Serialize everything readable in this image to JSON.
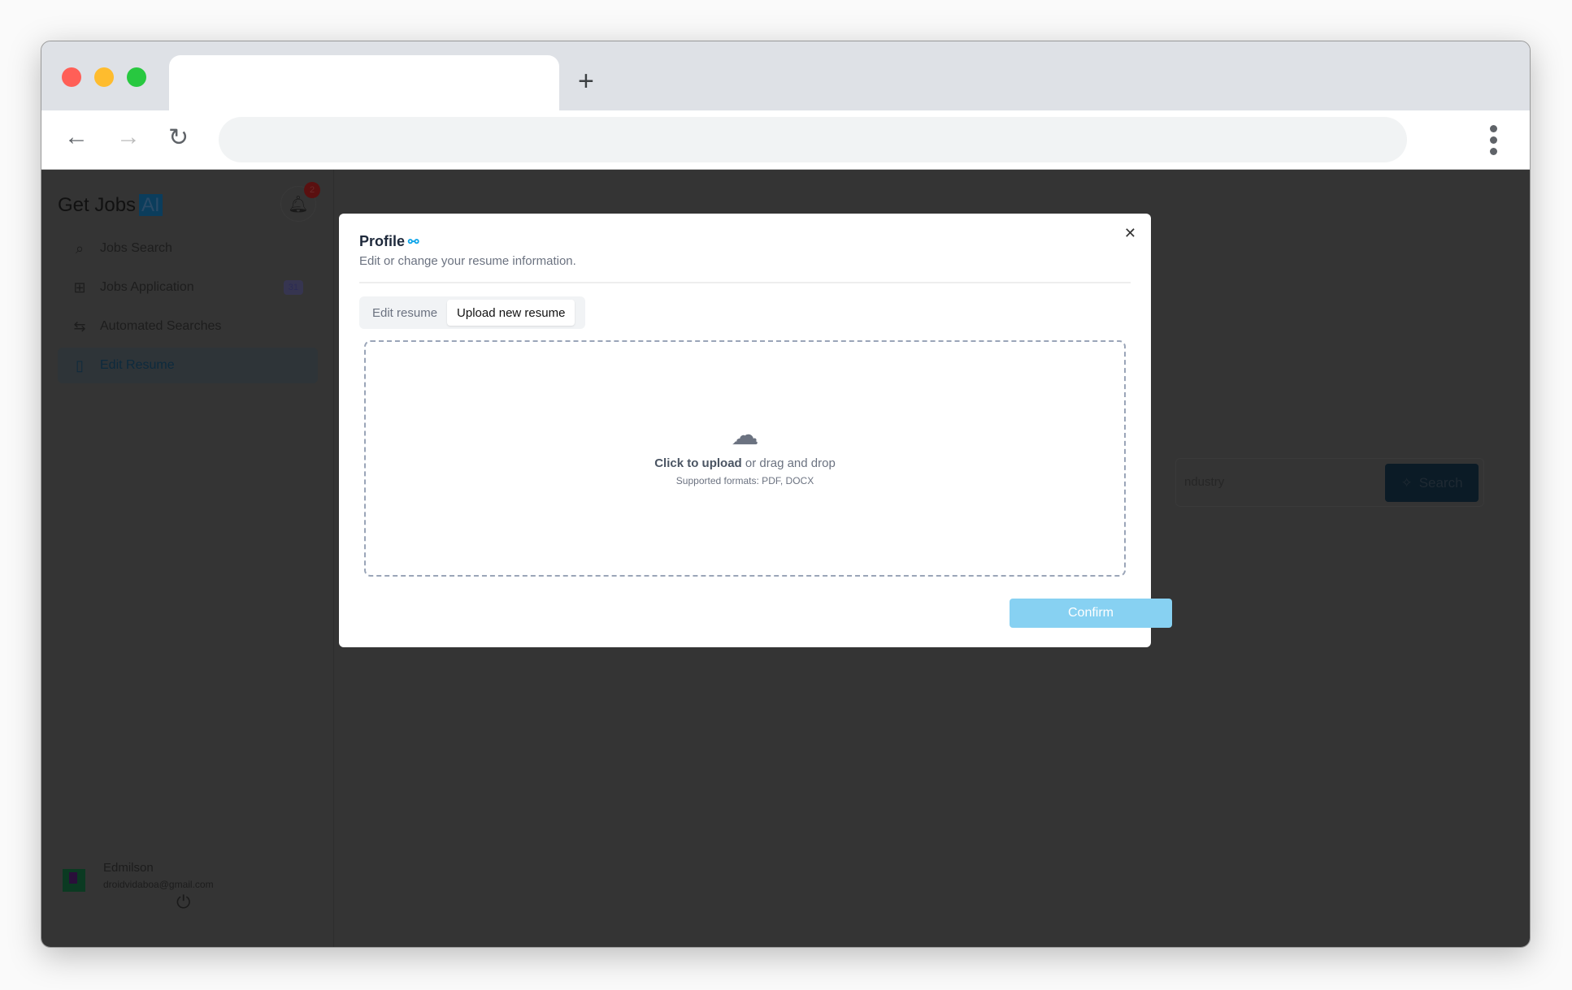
{
  "browser": {
    "new_tab": "+",
    "back": "←",
    "forward": "→",
    "reload": "↻"
  },
  "sidebar": {
    "logo": "Get Jobs",
    "logo_ai": "AI",
    "notification_count": "2",
    "items": [
      {
        "label": "Jobs Search",
        "icon": "⌕"
      },
      {
        "label": "Jobs Application",
        "icon": "⊞",
        "count": "31"
      },
      {
        "label": "Automated Searches",
        "icon": "⇆"
      },
      {
        "label": "Edit Resume",
        "icon": "▯"
      }
    ],
    "user": {
      "name": "Edmilson",
      "email": "droidvidaboa@gmail.com"
    }
  },
  "background": {
    "industry_placeholder": "ndustry",
    "search_label": "Search"
  },
  "modal": {
    "title": "Profile",
    "subtitle": "Edit or change your resume information.",
    "tabs": [
      "Edit resume",
      "Upload new resume"
    ],
    "upload": {
      "click": "Click to upload",
      "drag": " or drag and drop",
      "formats": "Supported formats: PDF, DOCX"
    },
    "confirm_label": "Confirm"
  }
}
